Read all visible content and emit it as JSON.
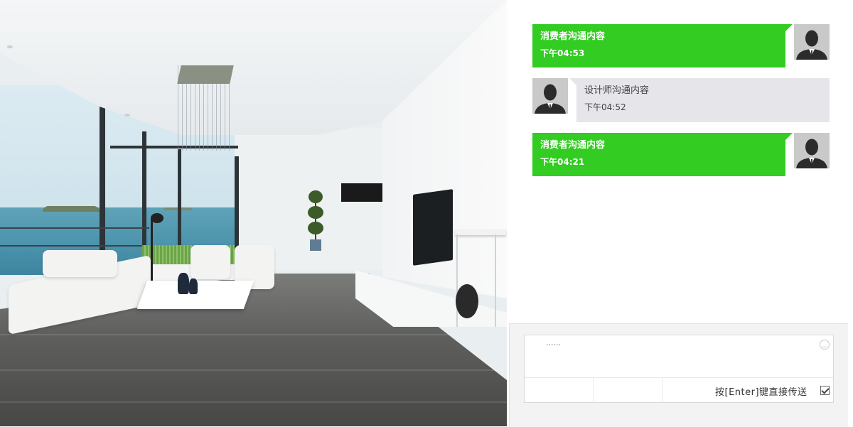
{
  "messages": [
    {
      "side": "right",
      "sender": "consumer",
      "text": "消费者沟通内容",
      "time": "下午04:53"
    },
    {
      "side": "left",
      "sender": "designer",
      "text": "设计师沟通内容",
      "time": "下午04:52"
    },
    {
      "side": "right",
      "sender": "consumer",
      "text": "消费者沟通内容",
      "time": "下午04:21"
    }
  ],
  "composer": {
    "value": "......",
    "send_hint": "按[Enter]键直接传送",
    "send_on_enter": true
  },
  "colors": {
    "consumer_bubble": "#33cc22",
    "designer_bubble": "#e5e5ea",
    "avatar_bg": "#c9c9c9"
  },
  "icons": [
    "avatar-silhouette-icon",
    "smiley-emoji-icon",
    "checkbox-checked-icon"
  ]
}
